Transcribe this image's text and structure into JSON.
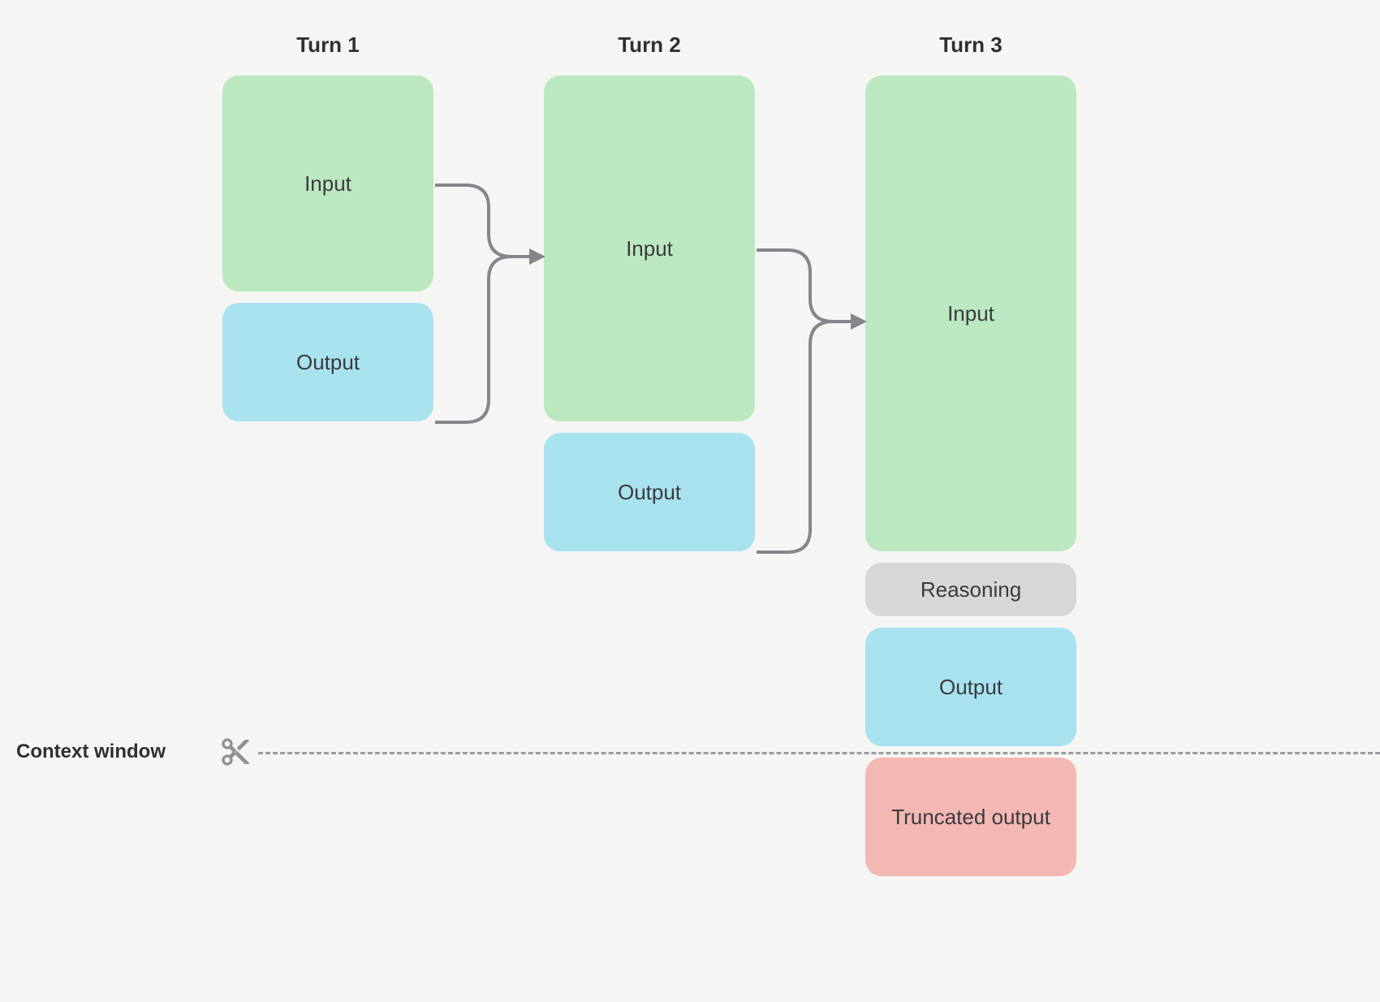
{
  "columns": [
    {
      "header": "Turn 1"
    },
    {
      "header": "Turn 2"
    },
    {
      "header": "Turn 3"
    }
  ],
  "blocks": {
    "turn1_input": "Input",
    "turn1_output": "Output",
    "turn2_input": "Input",
    "turn2_output": "Output",
    "turn3_input": "Input",
    "turn3_reason": "Reasoning",
    "turn3_output": "Output",
    "turn3_trunc": "Truncated output"
  },
  "context_window_label": "Context window",
  "colors": {
    "input": "#bbe8c0",
    "output": "#a9e2ef",
    "reason": "#d7d7d7",
    "trunc": "#f3b7b4",
    "bg": "#f5f5f4",
    "arrow": "#85858c",
    "dash": "#9a9aa1"
  }
}
